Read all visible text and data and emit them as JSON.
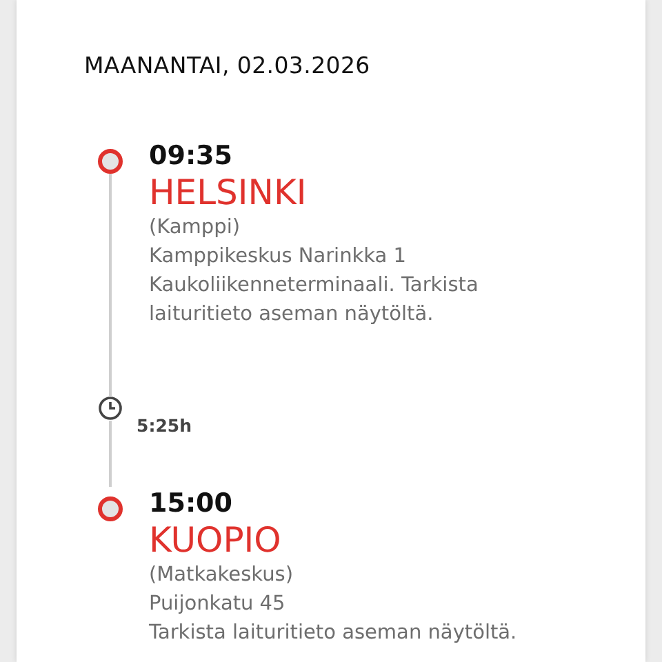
{
  "date": "MAANANTAI, 02.03.2026",
  "stops": [
    {
      "time": "09:35",
      "city": "HELSINKI",
      "details": [
        "(Kamppi)",
        "Kamppikeskus Narinkka 1",
        "Kaukoliikenneterminaali. Tarkista laituritieto aseman näytöltä."
      ]
    },
    {
      "time": "15:00",
      "city": "KUOPIO",
      "details": [
        "(Matkakeskus)",
        "Puijonkatu 45",
        "Tarkista laituritieto aseman näytöltä."
      ]
    }
  ],
  "duration": "5:25h"
}
